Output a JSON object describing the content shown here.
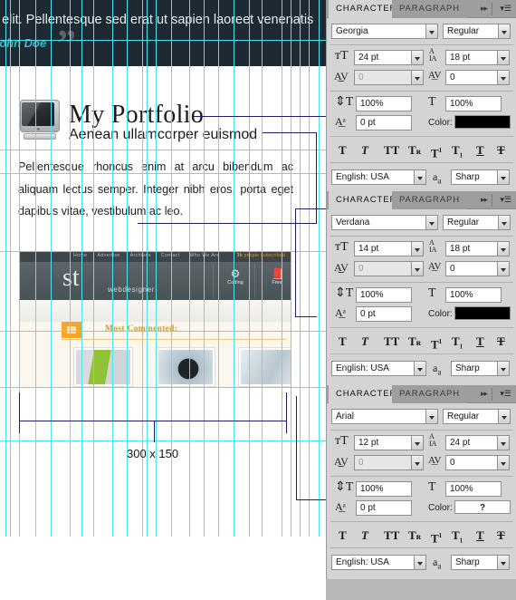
{
  "canvas": {
    "quote": {
      "text": "g elit. Pellentesque sed erat ut sapien laoreet venenatis",
      "author": "John Doe",
      "mark": "”"
    },
    "portfolio": {
      "title": "My Portfolio",
      "subtitle": "Aenean ullamcorper euismod",
      "body": "Pellentesque rhoncus enim at arcu bibendum ac aliquam lectus semper. Integer nibh eros, porta eget dapibus vitae, vestibulum ac leo."
    },
    "site_shot": {
      "nav": [
        "Home",
        "Advertise",
        "Archives",
        "Contact",
        "Who We Are"
      ],
      "promo_badge": "3k",
      "promo_text": "people subscribed",
      "logo": "st",
      "logo_sub": "webdesigner",
      "icon_labels": [
        "Coding",
        "Free"
      ],
      "section_heading": "Most Commented:"
    },
    "dimension_label": "300 x 150"
  },
  "panels": [
    {
      "tabs": {
        "active": "CHARACTER",
        "inactive": "PARAGRAPH"
      },
      "arrows_icon": "▸▸",
      "menu_icon": "▾☰",
      "font_family": "Georgia",
      "font_style": "Regular",
      "font_size": "24 pt",
      "leading": "18 pt",
      "kerning": "0",
      "tracking": "0",
      "vertical_scale": "100%",
      "horizontal_scale": "100%",
      "baseline_shift": "0 pt",
      "color_label": "Color:",
      "color_value": "#000000",
      "color_text": "",
      "language": "English: USA",
      "antialias_icon": "aₐ",
      "antialias": "Sharp",
      "style_buttons": [
        "T",
        "T",
        "TT",
        "Tr",
        "T1",
        "T1",
        "T",
        "T"
      ]
    },
    {
      "tabs": {
        "active": "CHARACTER",
        "inactive": "PARAGRAPH"
      },
      "arrows_icon": "▸▸",
      "menu_icon": "▾☰",
      "font_family": "Verdana",
      "font_style": "Regular",
      "font_size": "14 pt",
      "leading": "18 pt",
      "kerning": "0",
      "tracking": "0",
      "vertical_scale": "100%",
      "horizontal_scale": "100%",
      "baseline_shift": "0 pt",
      "color_label": "Color:",
      "color_value": "#000000",
      "color_text": "",
      "language": "English: USA",
      "antialias_icon": "aₐ",
      "antialias": "Sharp",
      "style_buttons": [
        "T",
        "T",
        "TT",
        "Tr",
        "T1",
        "T1",
        "T",
        "T"
      ]
    },
    {
      "tabs": {
        "active": "CHARACTER",
        "inactive": "PARAGRAPH"
      },
      "arrows_icon": "▸▸",
      "menu_icon": "▾☰",
      "font_family": "Arial",
      "font_style": "Regular",
      "font_size": "12 pt",
      "leading": "24 pt",
      "kerning": "0",
      "tracking": "0",
      "vertical_scale": "100%",
      "horizontal_scale": "100%",
      "baseline_shift": "0 pt",
      "color_label": "Color:",
      "color_value": "#ffffff",
      "color_text": "?",
      "language": "English: USA",
      "antialias_icon": "aₐ",
      "antialias": "Sharp",
      "style_buttons": [
        "T",
        "T",
        "TT",
        "Tr",
        "T1",
        "T1",
        "T",
        "T"
      ]
    }
  ]
}
